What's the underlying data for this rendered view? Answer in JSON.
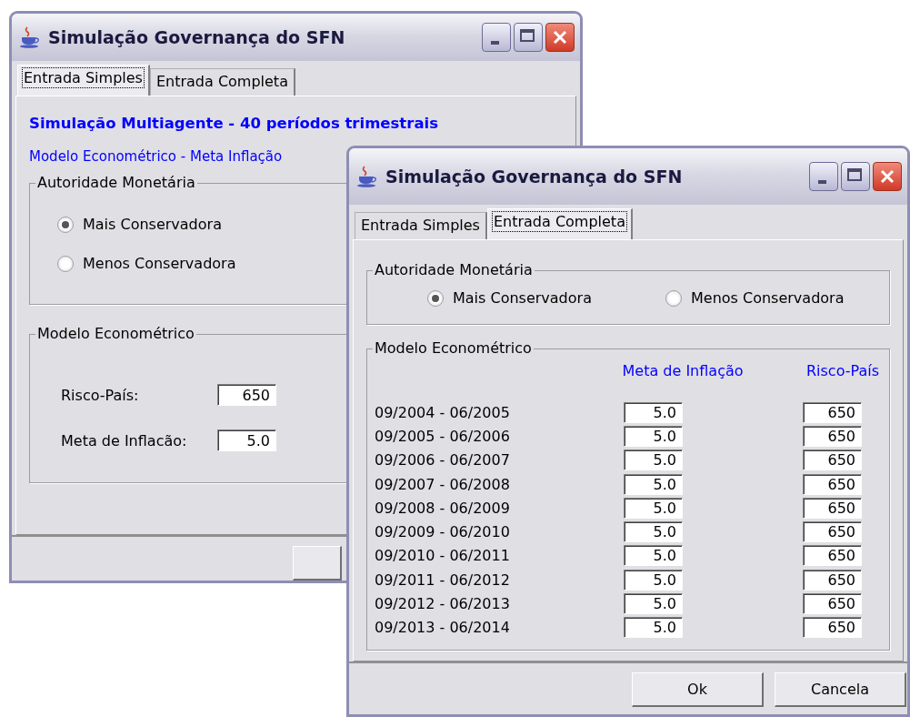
{
  "back_window": {
    "title": "Simulação Governança do SFN",
    "tabs": [
      {
        "label": "Entrada Simples",
        "selected": true
      },
      {
        "label": "Entrada Completa",
        "selected": false
      }
    ],
    "heading": "Simulação Multiagente - 40 períodos trimestrais",
    "subheading": "Modelo Econométrico - Meta Inflação",
    "authority": {
      "legend": "Autoridade Monetária",
      "options": [
        {
          "label": "Mais Conservadora",
          "selected": true
        },
        {
          "label": "Menos Conservadora",
          "selected": false
        }
      ]
    },
    "model": {
      "legend": "Modelo Econométrico",
      "fields": [
        {
          "label": "Risco-País:",
          "value": "650"
        },
        {
          "label": "Meta de Inflacão:",
          "value": "5.0"
        }
      ]
    }
  },
  "front_window": {
    "title": "Simulação Governança do SFN",
    "tabs": [
      {
        "label": "Entrada Simples",
        "selected": false
      },
      {
        "label": "Entrada Completa",
        "selected": true
      }
    ],
    "authority": {
      "legend": "Autoridade Monetária",
      "options": [
        {
          "label": "Mais Conservadora",
          "selected": true
        },
        {
          "label": "Menos Conservadora",
          "selected": false
        }
      ]
    },
    "model": {
      "legend": "Modelo Econométrico",
      "columns": [
        "Meta de Inflação",
        "Risco-País"
      ],
      "rows": [
        {
          "period": "09/2004 - 06/2005",
          "inflation": "5.0",
          "risk": "650"
        },
        {
          "period": "09/2005 - 06/2006",
          "inflation": "5.0",
          "risk": "650"
        },
        {
          "period": "09/2006 - 06/2007",
          "inflation": "5.0",
          "risk": "650"
        },
        {
          "period": "09/2007 - 06/2008",
          "inflation": "5.0",
          "risk": "650"
        },
        {
          "period": "09/2008 - 06/2009",
          "inflation": "5.0",
          "risk": "650"
        },
        {
          "period": "09/2009 - 06/2010",
          "inflation": "5.0",
          "risk": "650"
        },
        {
          "period": "09/2010 - 06/2011",
          "inflation": "5.0",
          "risk": "650"
        },
        {
          "period": "09/2011 - 06/2012",
          "inflation": "5.0",
          "risk": "650"
        },
        {
          "period": "09/2012 - 06/2013",
          "inflation": "5.0",
          "risk": "650"
        },
        {
          "period": "09/2013 - 06/2014",
          "inflation": "5.0",
          "risk": "650"
        }
      ]
    },
    "buttons": [
      "Ok",
      "Cancela"
    ]
  }
}
